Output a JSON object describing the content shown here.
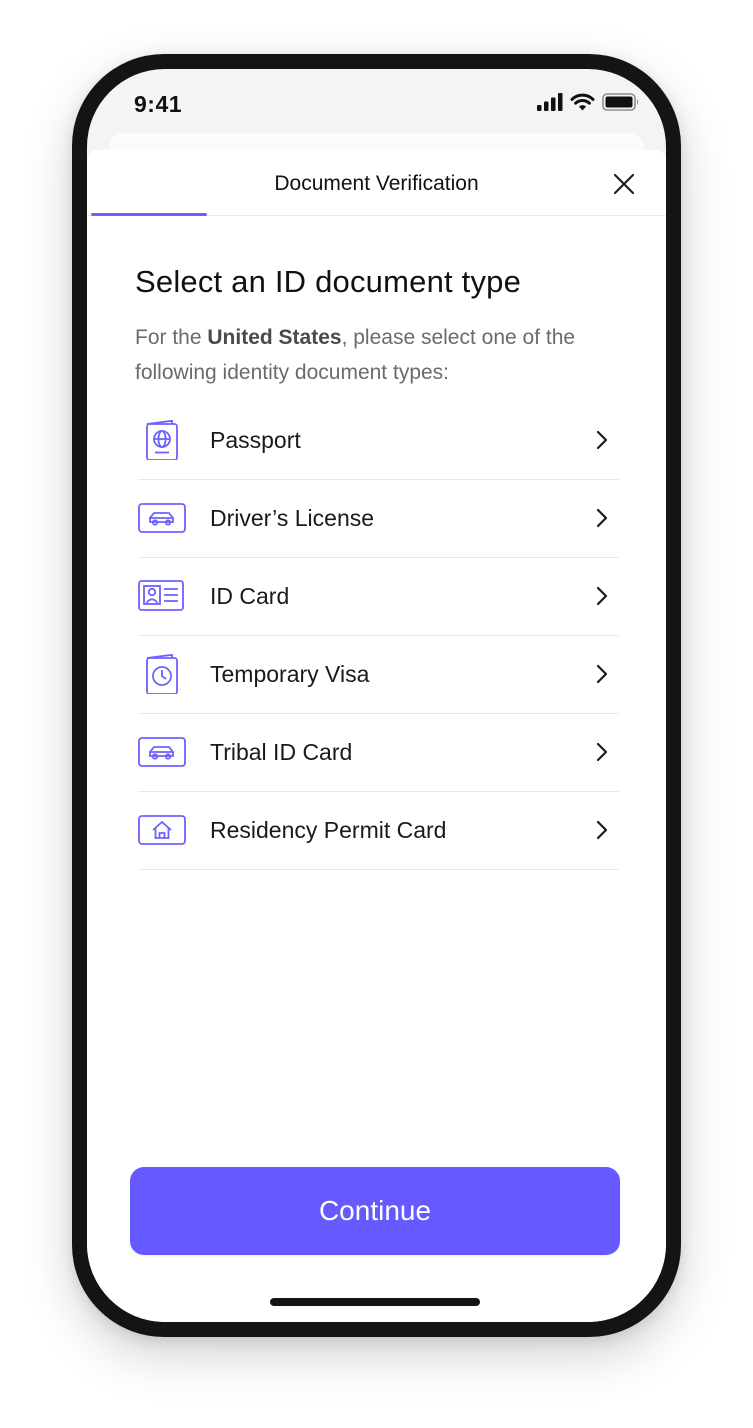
{
  "status_bar": {
    "time": "9:41",
    "icons": [
      "cellular-signal-icon",
      "wifi-icon",
      "battery-icon"
    ]
  },
  "header": {
    "title": "Document Verification",
    "close_icon": "close-icon",
    "progress_fraction": 0.2
  },
  "main": {
    "title": "Select an ID document type",
    "subtitle_prefix": "For the ",
    "subtitle_country": "United States",
    "subtitle_suffix": ", please select one of the following identity document types:"
  },
  "documents": [
    {
      "label": "Passport",
      "icon": "passport-icon"
    },
    {
      "label": "Driver’s License",
      "icon": "car-card-icon"
    },
    {
      "label": "ID Card",
      "icon": "id-card-icon"
    },
    {
      "label": "Temporary Visa",
      "icon": "visa-clock-icon"
    },
    {
      "label": "Tribal ID Card",
      "icon": "car-card-icon"
    },
    {
      "label": "Residency Permit Card",
      "icon": "house-card-icon"
    }
  ],
  "footer": {
    "continue_label": "Continue"
  },
  "colors": {
    "accent": "#6559ff",
    "icon_stroke": "#6c63ff",
    "text_primary": "#111111",
    "text_secondary": "#6b6b6b"
  }
}
